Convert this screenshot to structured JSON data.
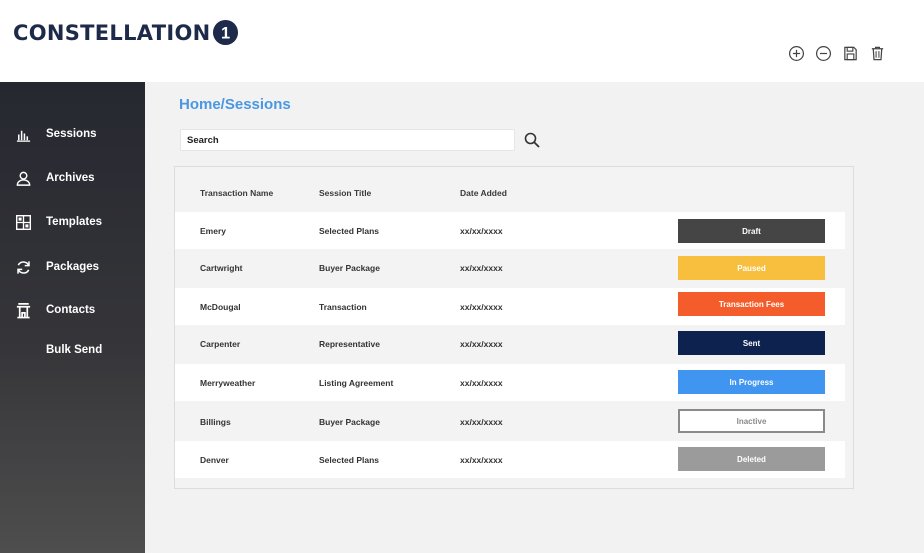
{
  "brand": {
    "name": "CONSTELLATION",
    "logo_mark": "1"
  },
  "toolbar": {
    "icons": [
      "add-circle-icon",
      "remove-circle-icon",
      "save-icon",
      "trash-icon"
    ]
  },
  "sidebar": {
    "items": [
      {
        "label": "Sessions",
        "icon": "bar-chart-icon"
      },
      {
        "label": "Archives",
        "icon": "user-icon"
      },
      {
        "label": "Templates",
        "icon": "grid-icon"
      },
      {
        "label": "Packages",
        "icon": "refresh-icon"
      },
      {
        "label": "Contacts",
        "icon": "building-icon"
      },
      {
        "label": "Bulk Send",
        "icon": ""
      }
    ]
  },
  "main": {
    "breadcrumb": "Home/Sessions",
    "search": {
      "value": "",
      "placeholder": "Search"
    }
  },
  "table": {
    "headers": [
      "Transaction Name",
      "Session Title",
      "Date Added"
    ],
    "rows": [
      {
        "name": "Emery",
        "title": "Selected Plans",
        "date": "xx/xx/xxxx",
        "status": "Draft"
      },
      {
        "name": "Cartwright",
        "title": "Buyer Package",
        "date": "xx/xx/xxxx",
        "status": "Paused"
      },
      {
        "name": "McDougal",
        "title": "Transaction",
        "date": "xx/xx/xxxx",
        "status": "Transaction Fees"
      },
      {
        "name": "Carpenter",
        "title": "Representative",
        "date": "xx/xx/xxxx",
        "status": "Sent"
      },
      {
        "name": "Merryweather",
        "title": "Listing Agreement",
        "date": "xx/xx/xxxx",
        "status": "In Progress"
      },
      {
        "name": "Billings",
        "title": "Buyer Package",
        "date": "xx/xx/xxxx",
        "status": "Inactive"
      },
      {
        "name": "Denver",
        "title": "Selected Plans",
        "date": "xx/xx/xxxx",
        "status": "Deleted"
      }
    ]
  },
  "colors": {
    "brand_navy": "#1e2a4a",
    "accent_blue": "#4a97e2",
    "status_draft": "#454545",
    "status_paused": "#f8bf3e",
    "status_transaction_fees": "#f45d2b",
    "status_sent": "#0e2250",
    "status_in_progress": "#3f95ef",
    "status_inactive": "#ffffff",
    "status_deleted": "#9b9b9b"
  }
}
